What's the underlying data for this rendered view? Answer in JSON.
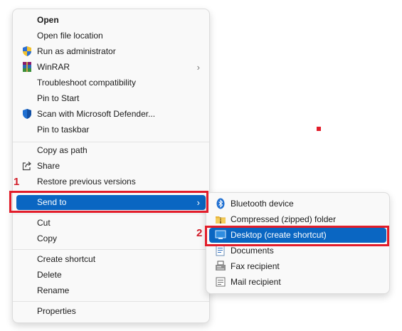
{
  "context_menu": {
    "items": [
      {
        "label": "Open"
      },
      {
        "label": "Open file location"
      },
      {
        "label": "Run as administrator",
        "icon": "uac-shield-icon"
      },
      {
        "label": "WinRAR",
        "icon": "winrar-icon",
        "submenu_chevron": "›"
      },
      {
        "label": "Troubleshoot compatibility"
      },
      {
        "label": "Pin to Start"
      },
      {
        "label": "Scan with Microsoft Defender...",
        "icon": "defender-shield-icon"
      },
      {
        "label": "Pin to taskbar"
      },
      {
        "label": "Copy as path"
      },
      {
        "label": "Share",
        "icon": "share-icon"
      },
      {
        "label": "Restore previous versions"
      },
      {
        "label": "Send to",
        "submenu_chevron": "›"
      },
      {
        "label": "Cut"
      },
      {
        "label": "Copy"
      },
      {
        "label": "Create shortcut"
      },
      {
        "label": "Delete"
      },
      {
        "label": "Rename"
      },
      {
        "label": "Properties"
      }
    ]
  },
  "send_to_menu": {
    "items": [
      {
        "label": "Bluetooth device",
        "icon": "bluetooth-icon"
      },
      {
        "label": "Compressed (zipped) folder",
        "icon": "zip-folder-icon"
      },
      {
        "label": "Desktop (create shortcut)",
        "icon": "desktop-icon"
      },
      {
        "label": "Documents",
        "icon": "documents-icon"
      },
      {
        "label": "Fax recipient",
        "icon": "fax-icon"
      },
      {
        "label": "Mail recipient",
        "icon": "mail-icon"
      }
    ]
  },
  "annotations": {
    "step1": "1",
    "step2": "2"
  },
  "colors": {
    "selection": "#0a66c2",
    "annotation_red": "#e21d2a"
  }
}
